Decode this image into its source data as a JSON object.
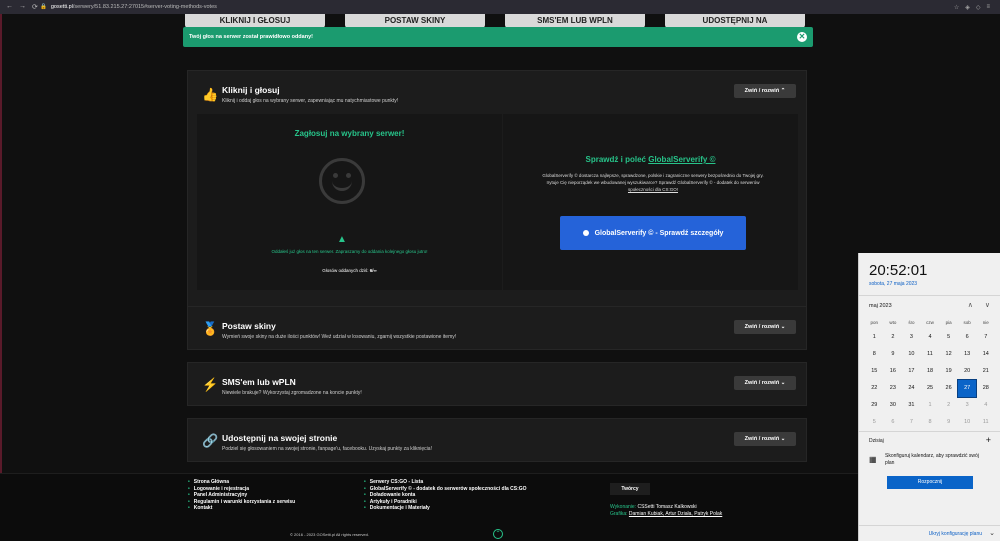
{
  "browser": {
    "url_host": "gosetti.pl",
    "url_path": "/serwery/51.83.215.27:27015#server-voting-methods-votes",
    "nav_back": "←",
    "nav_forward": "→",
    "nav_reload": "⟳"
  },
  "top_buttons": [
    "KLIKNIJ I GŁOSUJ",
    "POSTAW SKINY",
    "SMS'EM LUB WPLN",
    "UDOSTĘPNIJ NA"
  ],
  "toast": {
    "message": "Twój głos na serwer został prawidłowo oddany!",
    "close": "✕"
  },
  "cards": {
    "vote": {
      "title": "Kliknij i głosuj",
      "desc": "Kliknij i oddaj głos na wybrany serwer, zapewniając mu natychmiastowe punkty!",
      "toggle": "Zwiń / rozwiń ⌃"
    },
    "skins": {
      "title": "Postaw skiny",
      "desc": "Wymień swoje skiny na duże ilości punktów! Weź udział w losowaniu, zgarnij wszystkie postawione itemy!",
      "toggle": "Zwiń / rozwiń ⌄"
    },
    "sms": {
      "title": "SMS'em lub wPLN",
      "desc": "Niewiele brakuje? Wykorzystaj zgromadzone na koncie punkty!",
      "toggle": "Zwiń / rozwiń ⌄"
    },
    "share": {
      "title": "Udostępnij na swojej stronie",
      "desc": "Podziel się głosowaniem na swojej stronie, fanpage'u, facebooku. Uzyskaj punkty za kliknięcia!",
      "toggle": "Zwiń / rozwiń ⌄"
    }
  },
  "vote_panel": {
    "title": "Zagłosuj na wybrany serwer!",
    "message": "Oddałeś już głos na ten serwer. Zapraszamy do oddania kolejnego głosu jutro!",
    "count_label": "Głosów oddanych dziś:",
    "count_value": "6/∞"
  },
  "gs_panel": {
    "title_prefix": "Sprawdź i poleć",
    "title_link": "GlobalServerify ©",
    "body_line1": "GlobalServerify © dostarcza najlepsze, sprawdzone, polskie i zagraniczne serwery bezpośrednio do Twojej gry.",
    "body_line2": "Irytuje Cię nieporządek we wbudowanej wyszukiwarce? Sprawdź GlobalServerify © - dodatek do serwerów",
    "body_line3": "społeczności dla CS:GO!",
    "button": "GlobalServerify © - Sprawdź szczegóły"
  },
  "footer": {
    "col1": [
      "Strona Główna",
      "Logowanie i rejestracja",
      "Panel Administracyjny",
      "Regulamin i warunki korzystania z serwisu",
      "Kontakt"
    ],
    "col2": [
      "Serwery CS:GO - Lista",
      "GlobalServerify © - dodatek do serwerów społeczności dla CS:GO",
      "Doładowanie konta",
      "Artykuły i Poradniki",
      "Dokumentacje i Materiały"
    ],
    "creators_label": "Twórcy",
    "made_by_label": "Wykonanie:",
    "made_by": "CSSetti Tomasz Kalkowski",
    "graphics_label": "Grafika:",
    "graphics": "Damian Kubiak, Artur Działa, Patryk Polak",
    "copyright": "© 2016 - 2023 GOSetti.pl All rights reserved.",
    "scroll_top": "⌃"
  },
  "clock_panel": {
    "time": "20:52:01",
    "date": "sobota, 27 maja 2023",
    "month": "maj 2023",
    "weekdays": [
      "pon",
      "wto",
      "śro",
      "czw",
      "pia",
      "sob",
      "nie"
    ],
    "weeks": [
      [
        "1",
        "2",
        "3",
        "4",
        "5",
        "6",
        "7"
      ],
      [
        "8",
        "9",
        "10",
        "11",
        "12",
        "13",
        "14"
      ],
      [
        "15",
        "16",
        "17",
        "18",
        "19",
        "20",
        "21"
      ],
      [
        "22",
        "23",
        "24",
        "25",
        "26",
        "27",
        "28"
      ],
      [
        "29",
        "30",
        "31",
        "1",
        "2",
        "3",
        "4"
      ],
      [
        "5",
        "6",
        "7",
        "8",
        "9",
        "10",
        "11"
      ]
    ],
    "today_label": "Dzisiaj",
    "config_text": "Skonfiguruj kalendarz, aby sprawdzić swój plan",
    "start_button": "Rozpocznij",
    "hide_plan": "Ukryj konfigurację planu",
    "plus": "+",
    "arrow_up": "∧",
    "arrow_down": "∨"
  }
}
